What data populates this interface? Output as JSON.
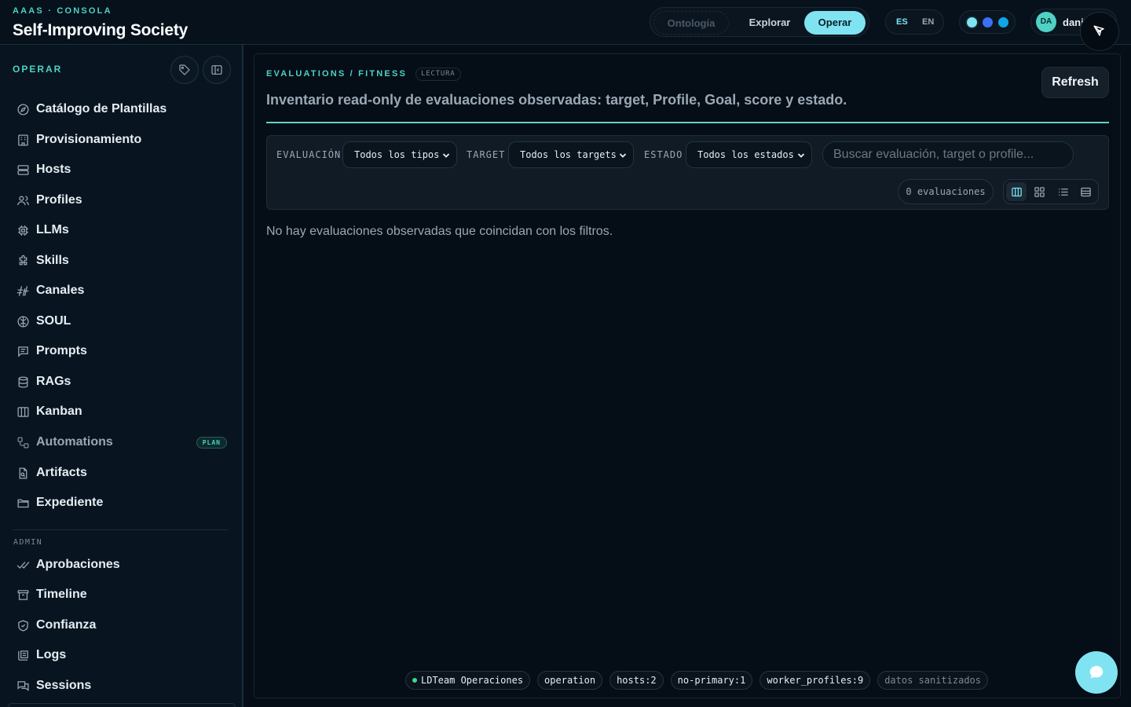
{
  "header": {
    "kicker": "AAAS · CONSOLA",
    "title": "Self-Improving Society",
    "modes": {
      "ontologia": "Ontología",
      "explorar": "Explorar",
      "operar": "Operar",
      "active": "Operar"
    },
    "langs": {
      "es": "ES",
      "en": "EN",
      "active": "ES"
    },
    "theme_colors": [
      "#7fe3f2",
      "#3b6ff5",
      "#0ea5e9"
    ],
    "user": {
      "initials": "DA",
      "name": "dani"
    }
  },
  "sidebar": {
    "title": "OPERAR",
    "items": [
      {
        "label": "Catálogo de Plantillas",
        "icon": "compass-icon"
      },
      {
        "label": "Provisionamiento",
        "icon": "building-icon"
      },
      {
        "label": "Hosts",
        "icon": "server-icon"
      },
      {
        "label": "Profiles",
        "icon": "users-icon"
      },
      {
        "label": "LLMs",
        "icon": "chip-icon"
      },
      {
        "label": "Skills",
        "icon": "puzzle-icon"
      },
      {
        "label": "Canales",
        "icon": "antenna-icon"
      },
      {
        "label": "SOUL",
        "icon": "brain-icon"
      },
      {
        "label": "Prompts",
        "icon": "message-icon"
      },
      {
        "label": "RAGs",
        "icon": "database-icon"
      },
      {
        "label": "Kanban",
        "icon": "columns-icon"
      },
      {
        "label": "Automations",
        "icon": "workflow-icon",
        "badge": "PLAN"
      },
      {
        "label": "Artifacts",
        "icon": "file-search-icon"
      },
      {
        "label": "Expediente",
        "icon": "folder-icon"
      }
    ],
    "admin_title": "ADMIN",
    "admin_items": [
      {
        "label": "Aprobaciones",
        "icon": "double-check-icon"
      },
      {
        "label": "Timeline",
        "icon": "archive-icon"
      },
      {
        "label": "Confianza",
        "icon": "shield-check-icon"
      },
      {
        "label": "Logs",
        "icon": "logs-icon"
      },
      {
        "label": "Sessions",
        "icon": "messages-icon"
      }
    ]
  },
  "main": {
    "kicker": "EVALUATIONS / FITNESS",
    "badge": "LECTURA",
    "refresh_label": "Refresh",
    "description": "Inventario read-only de evaluaciones observadas: target, Profile, Goal, score y estado.",
    "filters": {
      "evaluacion_label": "EVALUACIÓN",
      "evaluacion_value": "Todos los tipos",
      "target_label": "TARGET",
      "target_value": "Todos los targets",
      "estado_label": "ESTADO",
      "estado_value": "Todos los estados",
      "search_placeholder": "Buscar evaluación, target o profile..."
    },
    "count_label": "0 evaluaciones",
    "empty_message": "No hay evaluaciones observadas que coincidan con los filtros."
  },
  "footer": {
    "chips": [
      "LDTeam Operaciones",
      "operation",
      "hosts:2",
      "no-primary:1",
      "worker_profiles:9",
      "datos sanitizados"
    ]
  },
  "colors": {
    "accent": "#4fd1c5",
    "primary": "#7fe3f2",
    "background": "#050d16"
  }
}
